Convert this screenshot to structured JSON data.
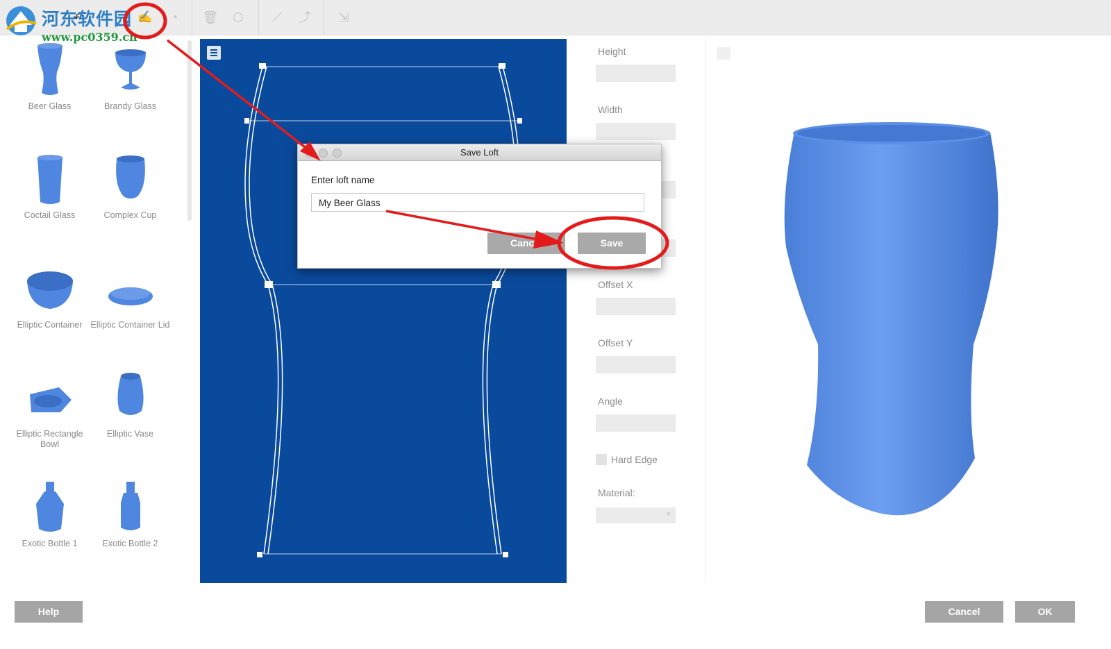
{
  "watermark": {
    "title": "河东软件园",
    "url": "www.pc0359.cn"
  },
  "toolbar": {
    "icons": [
      "home-icon",
      "undo-icon",
      "save-loft-icon",
      "load-icon",
      "delete-icon",
      "shape-icon",
      "line-icon",
      "curve-icon",
      "export-icon"
    ]
  },
  "library": {
    "items": [
      {
        "label": "Beer Glass"
      },
      {
        "label": "Brandy Glass"
      },
      {
        "label": "Coctail Glass"
      },
      {
        "label": "Complex Cup"
      },
      {
        "label": "Elliptic Container"
      },
      {
        "label": "Elliptic Container Lid"
      },
      {
        "label": "Elliptic Rectangle Bowl"
      },
      {
        "label": "Elliptic Vase"
      },
      {
        "label": "Exotic Bottle 1"
      },
      {
        "label": "Exotic Bottle 2"
      }
    ]
  },
  "properties": {
    "height_label": "Height",
    "width_label": "Width",
    "offset_x_label": "Offset X",
    "offset_y_label": "Offset Y",
    "angle_label": "Angle",
    "hard_edge_label": "Hard Edge",
    "material_label": "Material:"
  },
  "dialog": {
    "title": "Save Loft",
    "prompt": "Enter loft name",
    "input_value": "My Beer Glass",
    "cancel_label": "Cancel",
    "save_label": "Save"
  },
  "buttons": {
    "help": "Help",
    "cancel": "Cancel",
    "ok": "OK"
  },
  "colors": {
    "canvas": "#0a4a9c",
    "model": "#4f86e0",
    "annotation": "#e31b1b",
    "button": "#a5a5a5"
  }
}
